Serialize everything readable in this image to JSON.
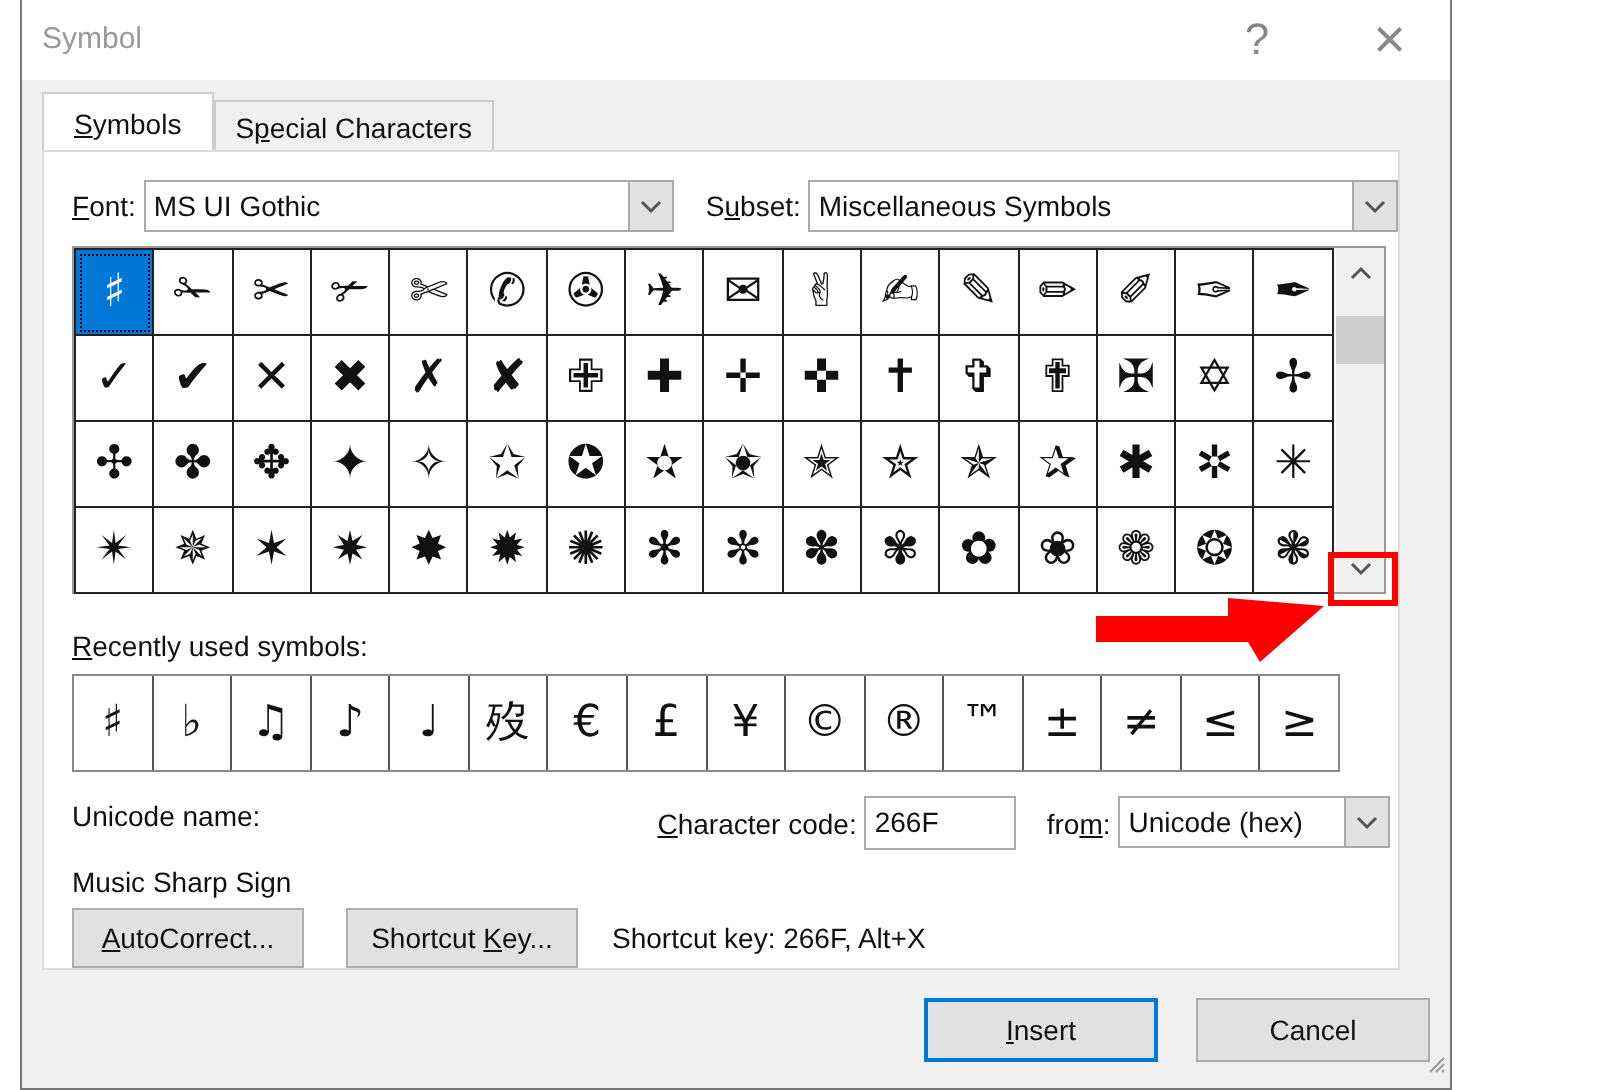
{
  "window": {
    "title": "Symbol",
    "help": "?",
    "close": "×"
  },
  "tabs": [
    {
      "accel": "S",
      "after": "ymbols",
      "selected": true
    },
    {
      "before": "S",
      "accel": "p",
      "after": "ecial Characters",
      "selected": false
    }
  ],
  "font": {
    "label": {
      "accel": "F",
      "after": "ont:"
    },
    "value": "MS UI Gothic"
  },
  "subset": {
    "label": {
      "before": "S",
      "accel": "u",
      "after": "bset:"
    },
    "value": "Miscellaneous Symbols"
  },
  "grid": [
    [
      {
        "char": "♯",
        "selected": true
      },
      {
        "char": "✁",
        "selected": false
      },
      {
        "char": "✂",
        "selected": false
      },
      {
        "char": "✃",
        "selected": false
      },
      {
        "char": "✄",
        "selected": false
      },
      {
        "char": "✆",
        "selected": false
      },
      {
        "char": "✇",
        "selected": false
      },
      {
        "char": "✈",
        "selected": false
      },
      {
        "char": "✉",
        "selected": false
      },
      {
        "char": "✌",
        "selected": false
      },
      {
        "char": "✍",
        "selected": false
      },
      {
        "char": "✎",
        "selected": false
      },
      {
        "char": "✏",
        "selected": false
      },
      {
        "char": "✐",
        "selected": false
      },
      {
        "char": "✑",
        "selected": false
      },
      {
        "char": "✒",
        "selected": false
      }
    ],
    [
      {
        "char": "✓",
        "selected": false
      },
      {
        "char": "✔",
        "selected": false
      },
      {
        "char": "✕",
        "selected": false
      },
      {
        "char": "✖",
        "selected": false
      },
      {
        "char": "✗",
        "selected": false
      },
      {
        "char": "✘",
        "selected": false
      },
      {
        "char": "✙",
        "selected": false
      },
      {
        "char": "✚",
        "selected": false
      },
      {
        "char": "✛",
        "selected": false
      },
      {
        "char": "✜",
        "selected": false
      },
      {
        "char": "✝",
        "selected": false
      },
      {
        "char": "✞",
        "selected": false
      },
      {
        "char": "✟",
        "selected": false
      },
      {
        "char": "✠",
        "selected": false
      },
      {
        "char": "✡",
        "selected": false
      },
      {
        "char": "✢",
        "selected": false
      }
    ],
    [
      {
        "char": "✣",
        "selected": false
      },
      {
        "char": "✤",
        "selected": false
      },
      {
        "char": "✥",
        "selected": false
      },
      {
        "char": "✦",
        "selected": false
      },
      {
        "char": "✧",
        "selected": false
      },
      {
        "char": "✩",
        "selected": false
      },
      {
        "char": "✪",
        "selected": false
      },
      {
        "char": "✫",
        "selected": false
      },
      {
        "char": "✬",
        "selected": false
      },
      {
        "char": "✭",
        "selected": false
      },
      {
        "char": "✮",
        "selected": false
      },
      {
        "char": "✯",
        "selected": false
      },
      {
        "char": "✰",
        "selected": false
      },
      {
        "char": "✱",
        "selected": false
      },
      {
        "char": "✲",
        "selected": false
      },
      {
        "char": "✳",
        "selected": false
      }
    ],
    [
      {
        "char": "✴",
        "selected": false
      },
      {
        "char": "✵",
        "selected": false
      },
      {
        "char": "✶",
        "selected": false
      },
      {
        "char": "✷",
        "selected": false
      },
      {
        "char": "✸",
        "selected": false
      },
      {
        "char": "✹",
        "selected": false
      },
      {
        "char": "✺",
        "selected": false
      },
      {
        "char": "✻",
        "selected": false
      },
      {
        "char": "✼",
        "selected": false
      },
      {
        "char": "✽",
        "selected": false
      },
      {
        "char": "✾",
        "selected": false
      },
      {
        "char": "✿",
        "selected": false
      },
      {
        "char": "❀",
        "selected": false
      },
      {
        "char": "❁",
        "selected": false
      },
      {
        "char": "❂",
        "selected": false
      },
      {
        "char": "❃",
        "selected": false
      }
    ]
  ],
  "recent": {
    "label": {
      "accel": "R",
      "after": "ecently used symbols:"
    },
    "symbols": [
      "♯",
      "♭",
      "♫",
      "♪",
      "♩",
      "歿",
      "€",
      "£",
      "¥",
      "©",
      "®",
      "™",
      "±",
      "≠",
      "≤",
      "≥"
    ]
  },
  "unicode_name": {
    "label": "Unicode name:",
    "value": "Music Sharp Sign"
  },
  "character_code": {
    "label": {
      "accel": "C",
      "after": "haracter code:"
    },
    "value": "266F"
  },
  "from": {
    "label": {
      "before": "fro",
      "accel": "m",
      "after": ":"
    },
    "value": "Unicode (hex)"
  },
  "buttons_left": [
    {
      "accel": "A",
      "after": "utoCorrect..."
    },
    {
      "before": "Shortcut ",
      "accel": "K",
      "after": "ey..."
    }
  ],
  "shortcut_text": "Shortcut key: 266F, Alt+X",
  "buttons_bottom": [
    {
      "accel": "I",
      "after": "nsert",
      "default": true
    },
    {
      "before": "Cancel",
      "default": false
    }
  ],
  "annotation": {
    "arrow": true,
    "scroll_highlight": true
  }
}
